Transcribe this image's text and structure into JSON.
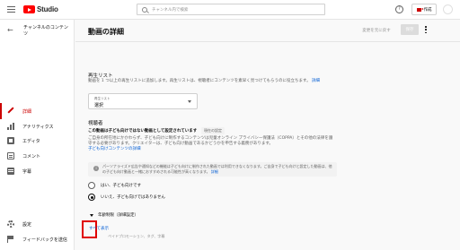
{
  "topbar": {
    "logo_text": "Studio",
    "search_placeholder": "チャンネル内で検索",
    "help_glyph": "?",
    "create_label": "作成"
  },
  "sidebar": {
    "channel_title": "チャンネルのコンテンツ",
    "items": [
      {
        "label": "詳細",
        "icon": "pencil-icon",
        "active": true
      },
      {
        "label": "アナリティクス",
        "icon": "analytics-icon"
      },
      {
        "label": "エディタ",
        "icon": "editor-icon"
      },
      {
        "label": "コメント",
        "icon": "comments-icon"
      },
      {
        "label": "字幕",
        "icon": "subtitles-icon"
      }
    ],
    "footer_items": [
      {
        "label": "設定",
        "icon": "gear-icon"
      },
      {
        "label": "フィードバックを送信",
        "icon": "feedback-icon"
      }
    ]
  },
  "header": {
    "title": "動画の詳細",
    "undo_label": "変更を元に戻す",
    "save_label": "保存"
  },
  "playlist": {
    "title": "再生リスト",
    "description": "動画を 1 つ以上の再生リストに追加します。再生リストは、視聴者にコンテンツを素早く見つけてもらうのに役立ちます。",
    "description_link": "詳細",
    "select_label": "再生リスト",
    "select_value": "選択"
  },
  "audience": {
    "title": "視聴者",
    "label": "この動画は子ども向けではない動画として設定されています",
    "badge": "現在の設定",
    "description": "ご自身の所在地にかかわらず、子ども向けに制作するコンテンツは児童オンライン プライバシー保護法（COPPA）とその他の法律を遵守する必要があります。クリエイターは、子ども向け動画であるかどうかを申告する義務があります。",
    "link": "子ども向けコンテンツの詳細",
    "info_text": "パーソナライズド広告や通知などの機能は子ども向けに制作された動画では利用できなくなります。ご自身で子ども向けと設定した動画は、他の子ども向け動画と一緒におすすめされる可能性が高くなります。",
    "info_link": "詳細",
    "info_icon": "i",
    "radio_yes": "はい、子ども向けです",
    "radio_no": "いいえ、子ども向けではありません",
    "age_restriction": "年齢制限（詳細設定）"
  },
  "more": {
    "show_all": "すべて表示",
    "show_all_sub": "ペイドプロモーション、タグ、字幕"
  }
}
